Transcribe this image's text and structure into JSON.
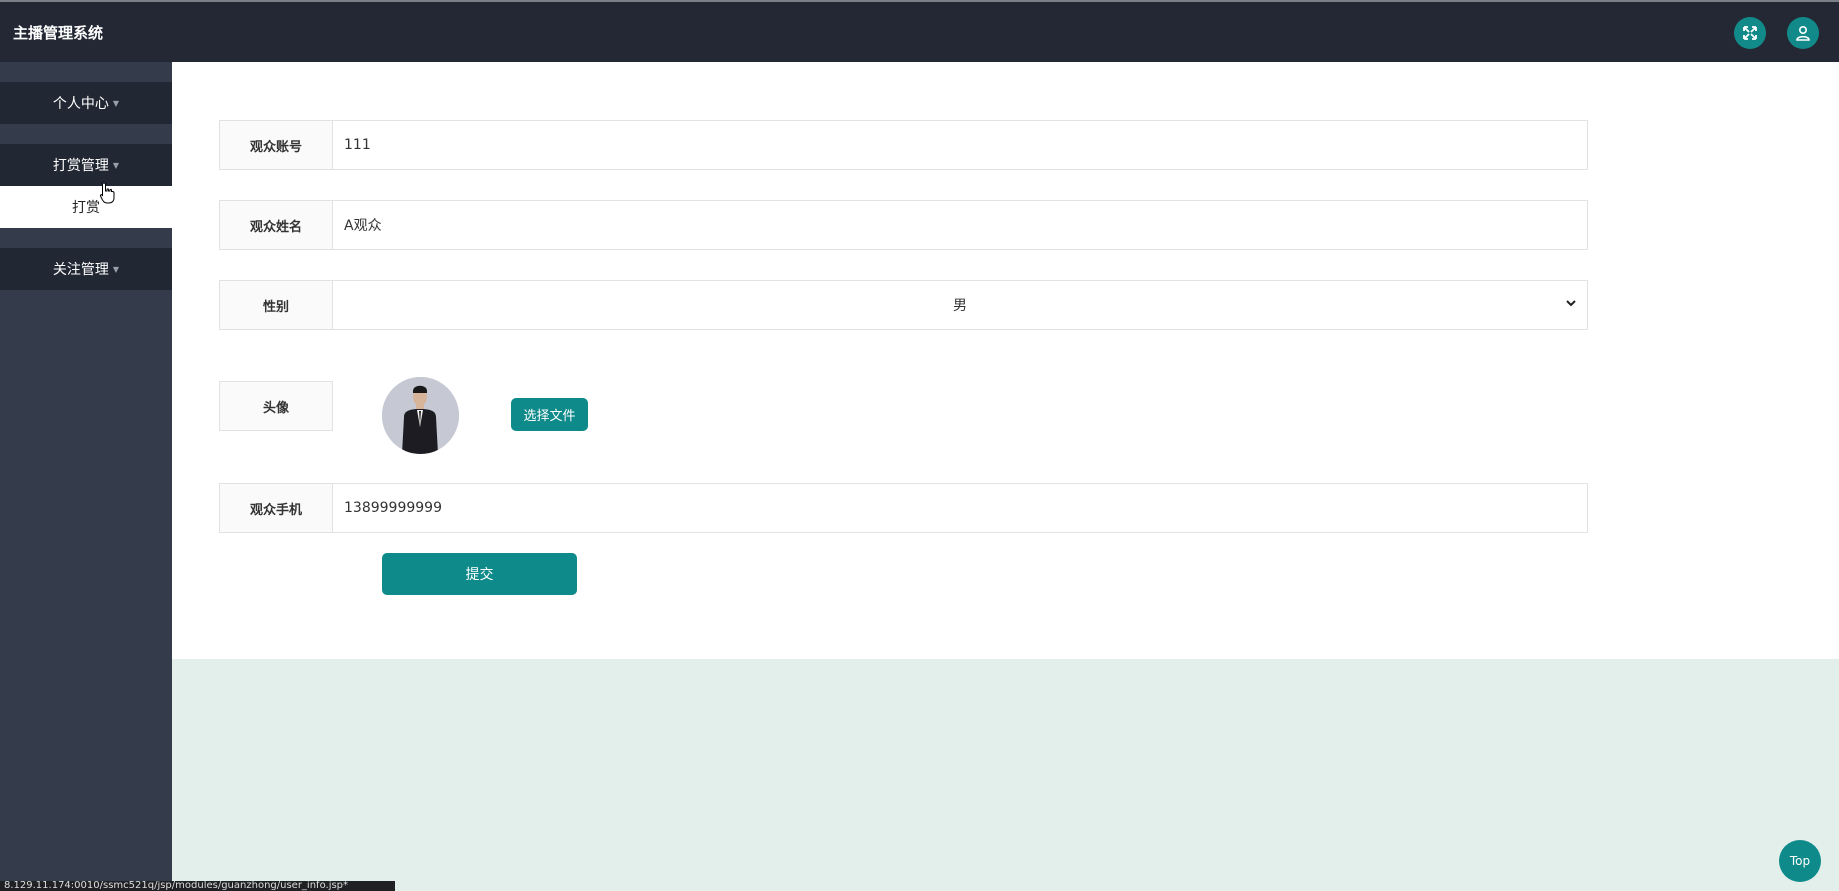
{
  "app": {
    "title": "主播管理系统"
  },
  "header": {
    "fullscreen_icon": "expand-arrows-icon",
    "user_icon": "user-icon",
    "accent_color": "#128a8a"
  },
  "sidebar": {
    "items": [
      {
        "label": "个人中心",
        "icon": "caret-down-icon"
      },
      {
        "label": "打赏管理",
        "icon": "caret-down-icon",
        "children": [
          {
            "label": "打赏"
          }
        ]
      },
      {
        "label": "关注管理",
        "icon": "caret-down-icon"
      }
    ]
  },
  "form": {
    "account": {
      "label": "观众账号",
      "value": "111"
    },
    "name": {
      "label": "观众姓名",
      "value": "A观众"
    },
    "gender": {
      "label": "性别",
      "value": "男"
    },
    "avatar": {
      "label": "头像",
      "choose_label": "选择文件"
    },
    "phone": {
      "label": "观众手机",
      "value": "13899999999"
    },
    "submit_label": "提交"
  },
  "top_button": {
    "label": "Top"
  },
  "status_url": "8.129.11.174:0010/ssmc521q/jsp/modules/guanzhong/user_info.jsp*"
}
